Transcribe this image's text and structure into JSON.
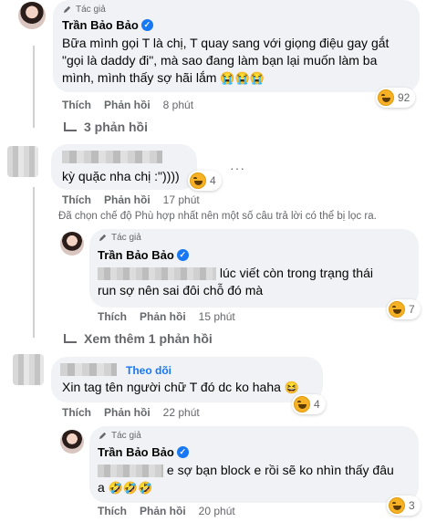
{
  "comment1": {
    "author_tag": "Tác giả",
    "name": "Trần Bảo Bảo",
    "text_lines": [
      "Bữa mình gọi T là chị, T quay sang với giọng điệu gay gắt",
      "\"gọi là daddy đi\", mà sao đang làm bạn lại muốn làm ba",
      "mình, mình thấy sợ hãi lắm"
    ],
    "emojis": "😭😭😭",
    "like": "Thích",
    "reply": "Phản hồi",
    "time": "8 phút",
    "reaction_count": "92",
    "replies_link": "3 phản hồi"
  },
  "comment2": {
    "text": "kỳ quặc nha chị :\"))))",
    "like": "Thích",
    "reply": "Phản hồi",
    "time": "17 phút",
    "reaction_count": "4",
    "more": "···"
  },
  "filter_note": "Đã chọn chế độ Phù hợp nhất nên một số câu trả lời có thể bị lọc ra.",
  "comment3": {
    "author_tag": "Tác giả",
    "name": "Trần Bảo Bảo",
    "line1": "lúc viết còn trong trạng thái",
    "line2": "run sợ nên sai đôi chỗ đó mà",
    "like": "Thích",
    "reply": "Phản hồi",
    "time": "15 phút",
    "reaction_count": "7"
  },
  "see_more": "Xem thêm 1 phản hồi",
  "comment4": {
    "follow": "Theo dõi",
    "text": "Xin tag tên người chữ T đó dc ko haha",
    "emoji": "😆",
    "like": "Thích",
    "reply": "Phản hồi",
    "time": "22 phút",
    "reaction_count": "4"
  },
  "comment5": {
    "author_tag": "Tác giả",
    "name": "Trần Bảo Bảo",
    "line1": "e sợ bạn block e rồi sẽ ko nhìn thấy đâu",
    "line2": "a",
    "emojis": "🤣🤣🤣",
    "like": "Thích",
    "reply": "Phản hồi",
    "time": "20 phút",
    "reaction_count": "3"
  },
  "colors": {
    "link_blue": "#1877f2",
    "bubble_gray": "#f0f2f5",
    "meta_gray": "#65676b"
  },
  "icons": {
    "author": "pen-icon",
    "verified": "verified-badge-icon",
    "reaction": "haha-reaction-icon"
  }
}
